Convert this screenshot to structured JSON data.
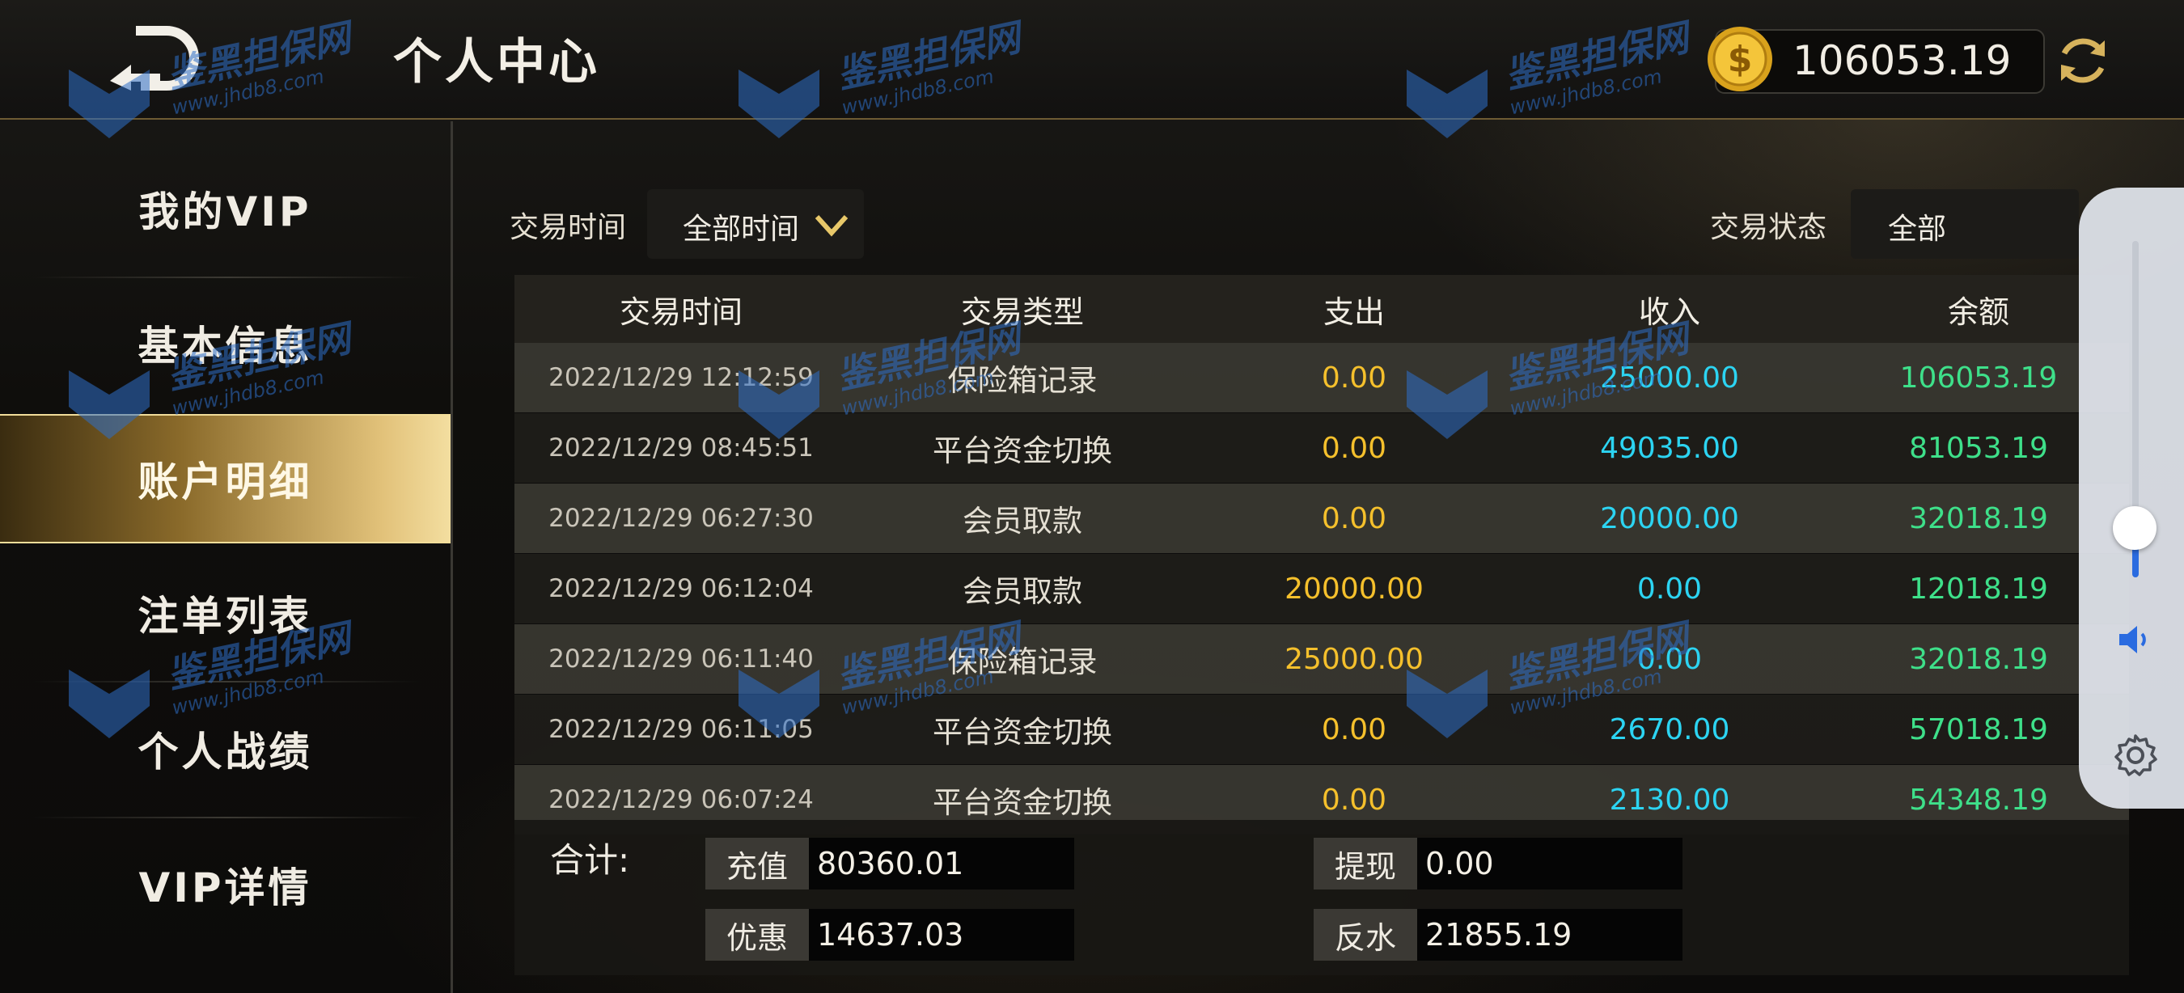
{
  "header": {
    "title": "个人中心",
    "balance": "106053.19"
  },
  "sidebar": {
    "items": [
      {
        "label": "我的VIP",
        "active": false
      },
      {
        "label": "基本信息",
        "active": false
      },
      {
        "label": "账户明细",
        "active": true
      },
      {
        "label": "注单列表",
        "active": false
      },
      {
        "label": "个人战绩",
        "active": false
      },
      {
        "label": "VIP详情",
        "active": false
      }
    ]
  },
  "filters": {
    "time_label": "交易时间",
    "time_value": "全部时间",
    "status_label": "交易状态",
    "status_value": "全部"
  },
  "table": {
    "headers": [
      "交易时间",
      "交易类型",
      "支出",
      "收入",
      "余额"
    ],
    "rows": [
      [
        "2022/12/29 12:12:59",
        "保险箱记录",
        "0.00",
        "25000.00",
        "106053.19"
      ],
      [
        "2022/12/29 08:45:51",
        "平台资金切换",
        "0.00",
        "49035.00",
        "81053.19"
      ],
      [
        "2022/12/29 06:27:30",
        "会员取款",
        "0.00",
        "20000.00",
        "32018.19"
      ],
      [
        "2022/12/29 06:12:04",
        "会员取款",
        "20000.00",
        "0.00",
        "12018.19"
      ],
      [
        "2022/12/29 06:11:40",
        "保险箱记录",
        "25000.00",
        "0.00",
        "32018.19"
      ],
      [
        "2022/12/29 06:11:05",
        "平台资金切换",
        "0.00",
        "2670.00",
        "57018.19"
      ],
      [
        "2022/12/29 06:07:24",
        "平台资金切换",
        "0.00",
        "2130.00",
        "54348.19"
      ]
    ]
  },
  "totals": {
    "label": "合计:",
    "recharge_label": "充值",
    "recharge_value": "80360.01",
    "withdraw_label": "提现",
    "withdraw_value": "0.00",
    "discount_label": "优惠",
    "discount_value": "14637.03",
    "rebate_label": "反水",
    "rebate_value": "21855.19"
  },
  "volume": {
    "level": 0.15
  },
  "watermark": {
    "text": "鉴黑担保网",
    "url": "www.jhdb8.com"
  },
  "colors": {
    "expense": "#f5c02c",
    "income": "#2cd4f2",
    "balance": "#3ee08a",
    "active_gold": "#e2c27a",
    "watermark_blue": "#2e6fc9"
  }
}
